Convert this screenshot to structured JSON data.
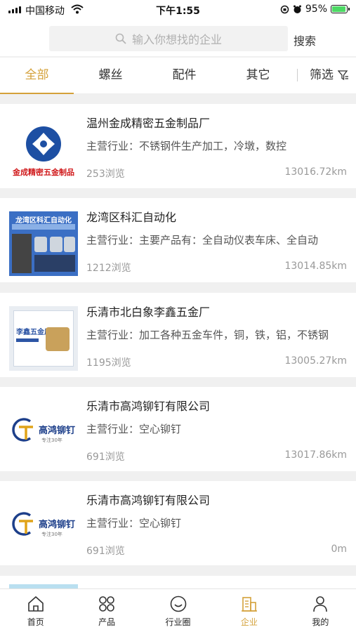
{
  "status_bar": {
    "carrier": "中国移动",
    "time": "下午1:55",
    "battery": "95%"
  },
  "search": {
    "placeholder": "输入你想找的企业",
    "button": "搜索"
  },
  "tabs": [
    "全部",
    "螺丝",
    "配件",
    "其它"
  ],
  "filter_label": "筛选",
  "companies": [
    {
      "name": "温州金成精密五金制品厂",
      "industry": "主营行业：不锈钢件生产加工，冷墩，数控",
      "views": "253浏览",
      "distance": "13016.72km",
      "logo_text": "金成精密五金制品"
    },
    {
      "name": "龙湾区科汇自动化",
      "industry": "主营行业：主要产品有：全自动仪表车床、全自动",
      "views": "1212浏览",
      "distance": "13014.85km",
      "logo_text": "龙湾区科汇自动化"
    },
    {
      "name": "乐清市北白象李鑫五金厂",
      "industry": "主营行业：加工各种五金车件，铜，铁，铝，不锈钢",
      "views": "1195浏览",
      "distance": "13005.27km",
      "logo_text": "李鑫五金厂"
    },
    {
      "name": "乐清市高鸿铆钉有限公司",
      "industry": "主营行业：空心铆钉",
      "views": "691浏览",
      "distance": "13017.86km",
      "logo_text": "高鸿铆钉",
      "logo_sub": "专注30年"
    },
    {
      "name": "乐清市高鸿铆钉有限公司",
      "industry": "主营行业：空心铆钉",
      "views": "691浏览",
      "distance": "0m",
      "logo_text": "高鸿铆钉",
      "logo_sub": "专注30年"
    }
  ],
  "bottom_nav": [
    "首页",
    "产品",
    "行业圈",
    "企业",
    "我的"
  ],
  "colors": {
    "accent": "#d4a13a",
    "background": "#f0f0f0"
  }
}
